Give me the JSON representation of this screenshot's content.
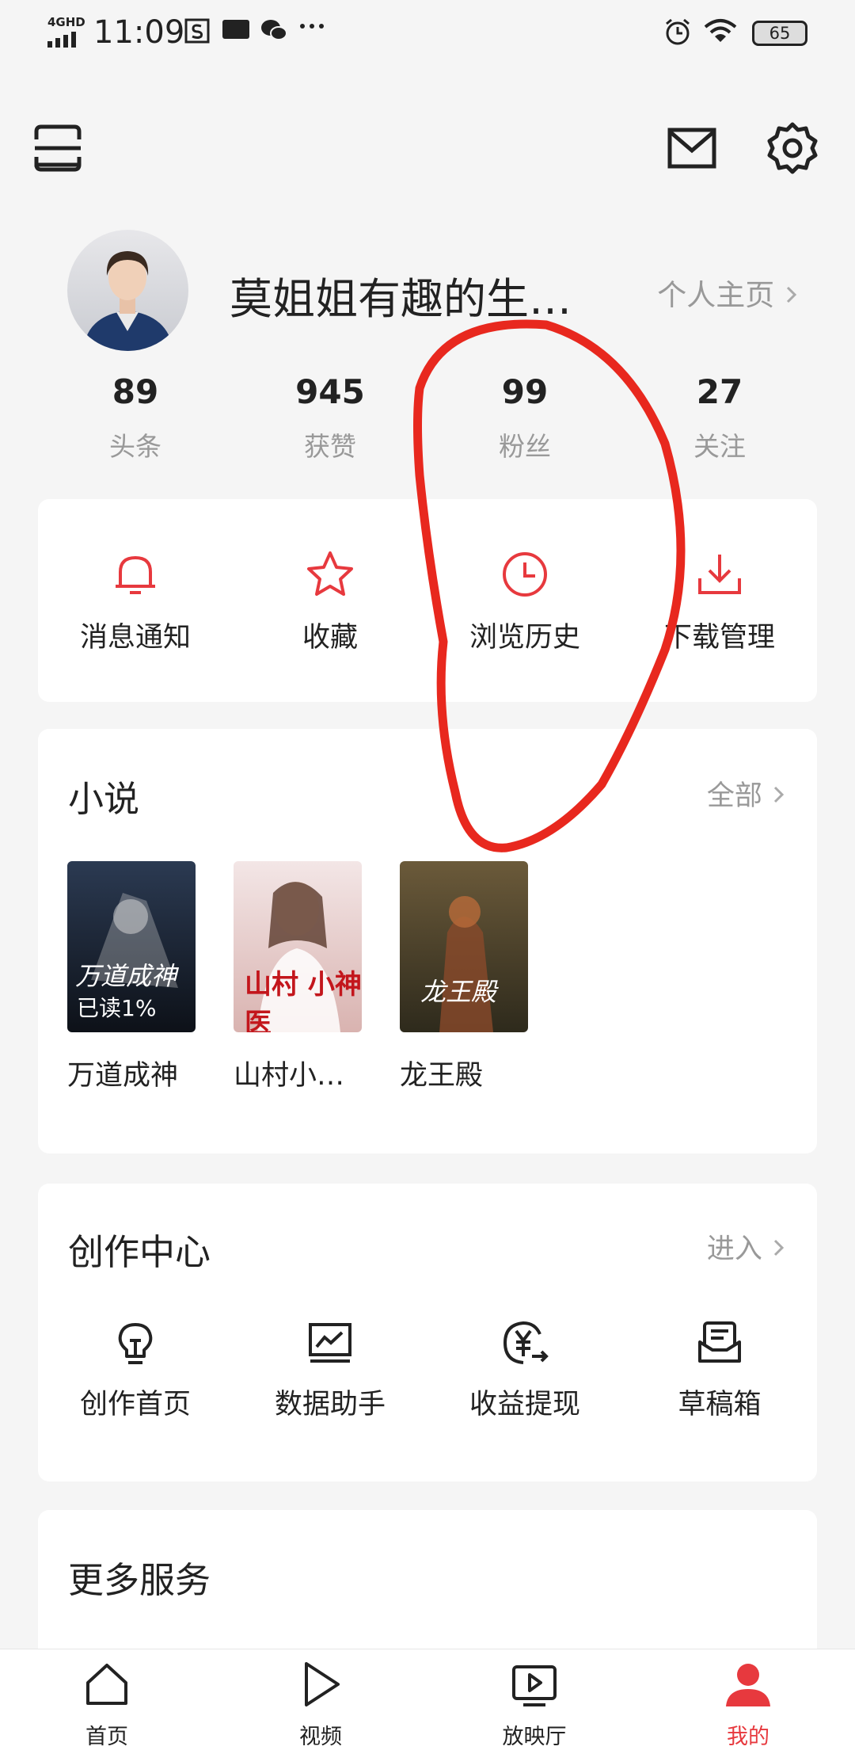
{
  "status_bar": {
    "network": "4GHD",
    "time": "11:09",
    "battery": "65"
  },
  "profile": {
    "name": "莫姐姐有趣的生…",
    "homepage_label": "个人主页"
  },
  "stats": [
    {
      "value": "89",
      "label": "头条"
    },
    {
      "value": "945",
      "label": "获赞"
    },
    {
      "value": "99",
      "label": "粉丝"
    },
    {
      "value": "27",
      "label": "关注"
    }
  ],
  "quick_actions": [
    {
      "label": "消息通知",
      "icon": "bell-icon"
    },
    {
      "label": "收藏",
      "icon": "star-icon"
    },
    {
      "label": "浏览历史",
      "icon": "clock-icon"
    },
    {
      "label": "下载管理",
      "icon": "download-icon"
    }
  ],
  "novels": {
    "title": "小说",
    "more_label": "全部",
    "books": [
      {
        "title": "万道成神",
        "cover_text": "万道成神",
        "progress": "已读1%",
        "color_top": "#2b3a52",
        "color_bottom": "#0d1118"
      },
      {
        "title": "山村小…",
        "cover_text": "山村 小神医",
        "progress": "",
        "color_top": "#f3e6e6",
        "color_bottom": "#d9b3b0"
      },
      {
        "title": "龙王殿",
        "cover_text": "龙王殿",
        "progress": "",
        "color_top": "#6b5a3a",
        "color_bottom": "#2e2a1c"
      }
    ]
  },
  "creation_center": {
    "title": "创作中心",
    "more_label": "进入",
    "items": [
      {
        "label": "创作首页",
        "icon": "lightbulb-icon"
      },
      {
        "label": "数据助手",
        "icon": "chart-icon"
      },
      {
        "label": "收益提现",
        "icon": "yen-icon"
      },
      {
        "label": "草稿箱",
        "icon": "draft-box-icon"
      }
    ]
  },
  "more_services": {
    "title": "更多服务"
  },
  "tabbar": [
    {
      "label": "首页",
      "icon": "home-icon"
    },
    {
      "label": "视频",
      "icon": "play-icon"
    },
    {
      "label": "放映厅",
      "icon": "tv-play-icon"
    },
    {
      "label": "我的",
      "icon": "person-icon"
    }
  ],
  "colors": {
    "accent": "#e7393e",
    "annotation": "#e8281e"
  }
}
